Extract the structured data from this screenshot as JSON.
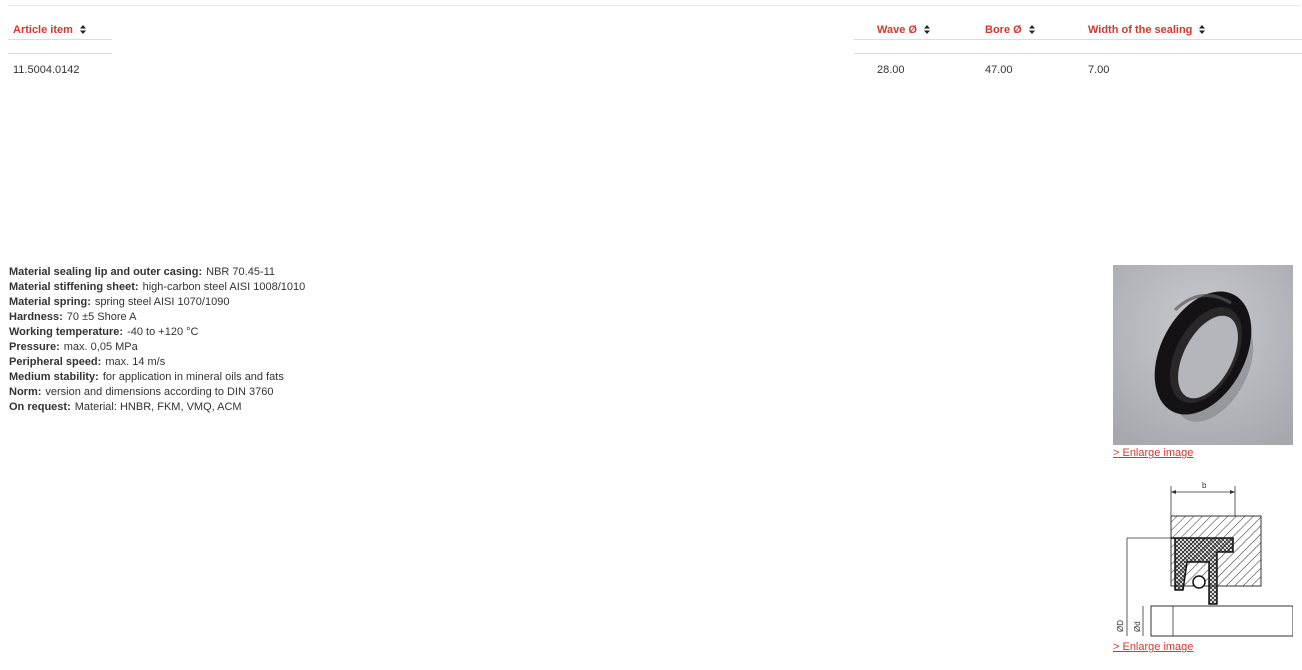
{
  "table": {
    "headers": {
      "article": "Article item",
      "wave": "Wave Ø",
      "bore": "Bore Ø",
      "width": "Width of the sealing"
    },
    "rows": [
      {
        "article": "11.5004.0142",
        "wave": "28.00",
        "bore": "47.00",
        "width": "7.00"
      }
    ]
  },
  "specs": [
    {
      "label": "Material sealing lip and outer casing:",
      "value": "NBR 70.45-11"
    },
    {
      "label": "Material stiffening sheet:",
      "value": "high-carbon steel AISI 1008/1010"
    },
    {
      "label": "Material spring:",
      "value": "spring steel AISI 1070/1090"
    },
    {
      "label": "Hardness:",
      "value": "70 ±5 Shore A"
    },
    {
      "label": "Working temperature:",
      "value": "-40 to +120 °C"
    },
    {
      "label": "Pressure:",
      "value": "max. 0,05 MPa"
    },
    {
      "label": "Peripheral speed:",
      "value": "max. 14 m/s"
    },
    {
      "label": "Medium stability:",
      "value": "for application in mineral oils and fats"
    },
    {
      "label": "Norm:",
      "value": "version and dimensions according to DIN 3760"
    },
    {
      "label": "On request:",
      "value": "Material: HNBR, FKM, VMQ, ACM"
    }
  ],
  "images": {
    "enlarge_1": "> Enlarge image",
    "enlarge_2": "> Enlarge image",
    "drawing_labels": {
      "b": "b",
      "D": "ØD",
      "d": "Ød"
    }
  },
  "colors": {
    "accent": "#d2382f",
    "photo_bg": "#b8b9bf",
    "seal": "#141214"
  }
}
